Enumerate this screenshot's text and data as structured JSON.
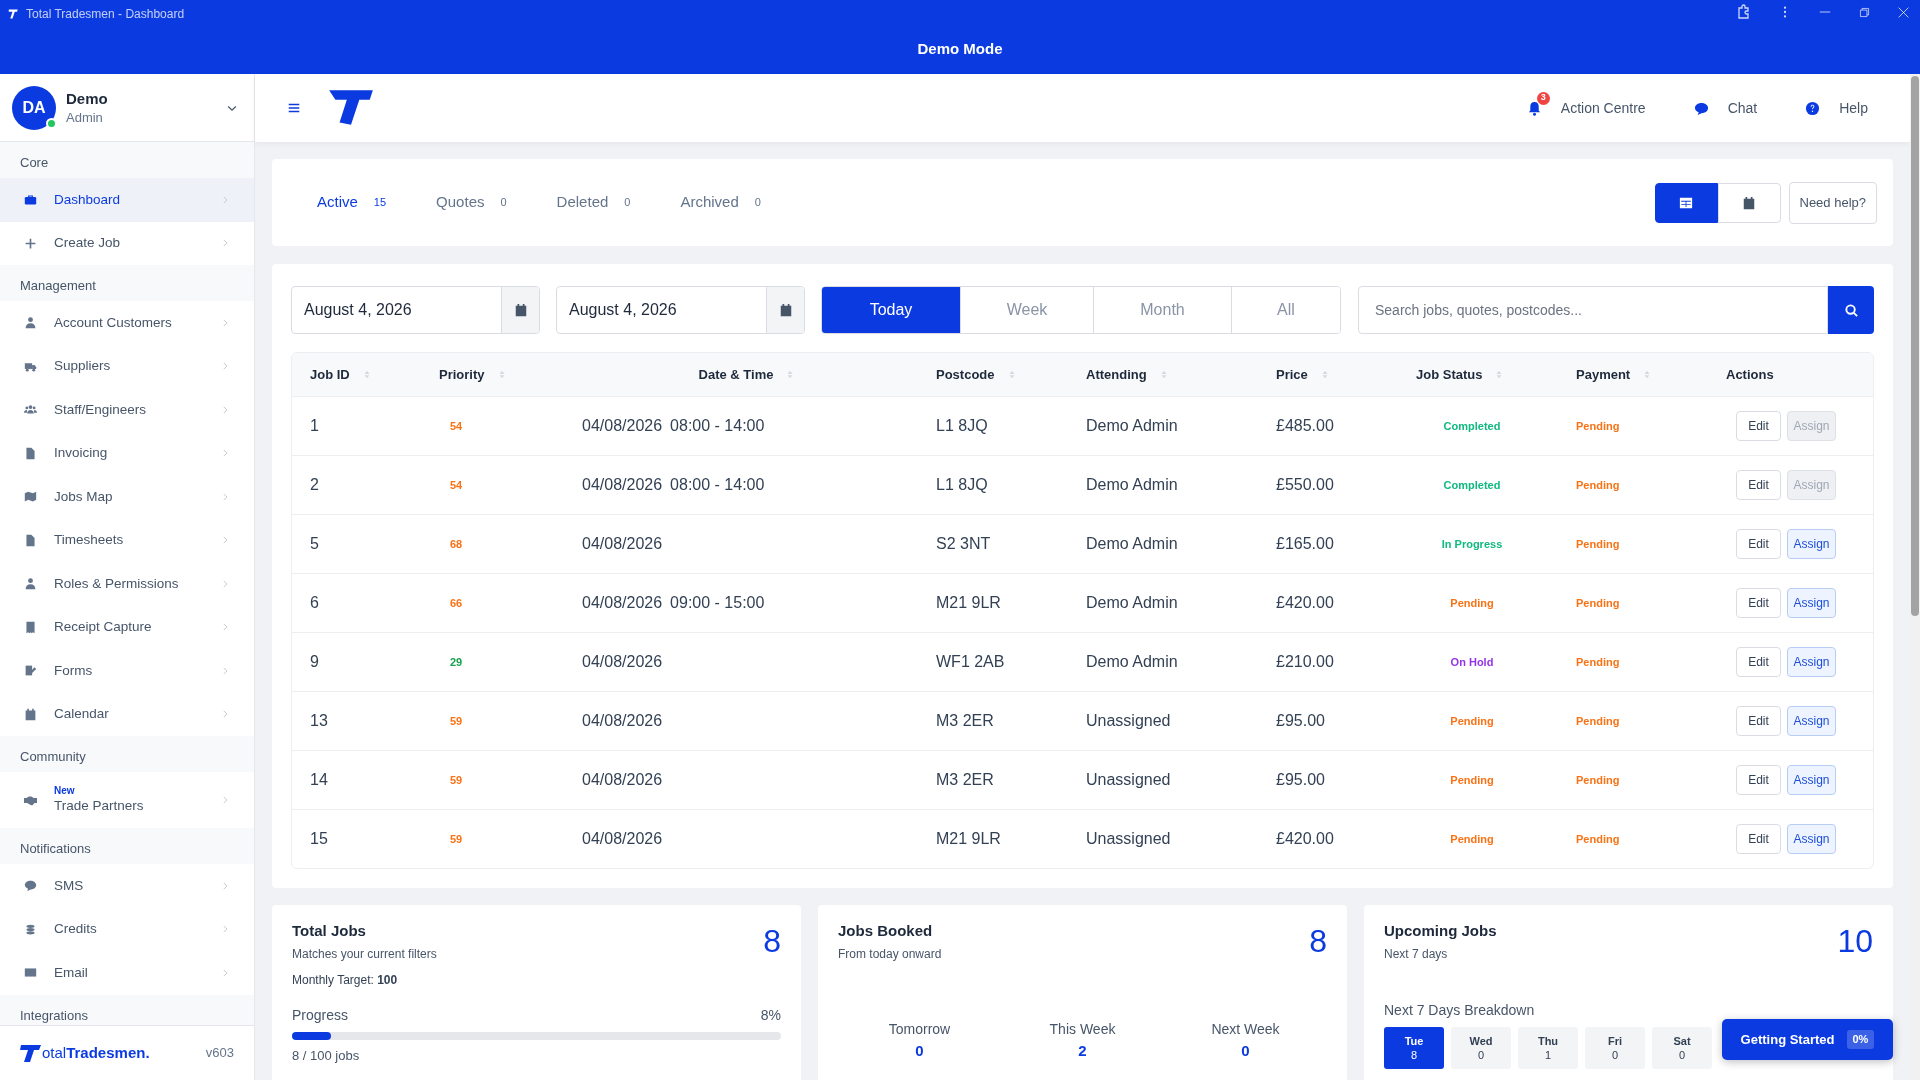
{
  "titlebar": {
    "title": "Total Tradesmen - Dashboard",
    "banner": "Demo Mode"
  },
  "user": {
    "initials": "DA",
    "name": "Demo",
    "role": "Admin",
    "online": true
  },
  "sidebar": {
    "sections": [
      {
        "title": "Core",
        "items": [
          {
            "label": "Dashboard",
            "selected": true
          },
          {
            "label": "Create Job",
            "selected": false
          }
        ]
      },
      {
        "title": "Management",
        "items": [
          {
            "label": "Account Customers",
            "selected": false
          },
          {
            "label": "Suppliers",
            "selected": false
          },
          {
            "label": "Staff/Engineers",
            "selected": false
          },
          {
            "label": "Invoicing",
            "selected": false
          },
          {
            "label": "Jobs Map",
            "selected": false
          },
          {
            "label": "Timesheets",
            "selected": false
          },
          {
            "label": "Roles & Permissions",
            "selected": false
          },
          {
            "label": "Receipt Capture",
            "selected": false
          },
          {
            "label": "Forms",
            "selected": false
          },
          {
            "label": "Calendar",
            "selected": false
          }
        ]
      },
      {
        "title": "Community",
        "items": [
          {
            "label": "Trade Partners",
            "badge": "New",
            "selected": false
          }
        ]
      },
      {
        "title": "Notifications",
        "items": [
          {
            "label": "SMS",
            "selected": false
          },
          {
            "label": "Credits",
            "selected": false
          },
          {
            "label": "Email",
            "selected": false
          }
        ]
      },
      {
        "title": "Integrations"
      }
    ],
    "footer": {
      "brand": "otal**Tradesmen.**",
      "version": "v603"
    }
  },
  "header": {
    "actions": [
      {
        "label": "Action Centre",
        "badge": "3"
      },
      {
        "label": "Chat"
      },
      {
        "label": "Help"
      }
    ]
  },
  "tabs": [
    {
      "label": "Active",
      "count": "15",
      "selected": true
    },
    {
      "label": "Quotes",
      "count": "0",
      "selected": false
    },
    {
      "label": "Deleted",
      "count": "0",
      "selected": false
    },
    {
      "label": "Archived",
      "count": "0",
      "selected": false
    }
  ],
  "views": [
    {
      "kind": "table",
      "selected": true
    },
    {
      "kind": "calendar",
      "selected": false
    }
  ],
  "help_button": "Need help?",
  "filters": {
    "date_from": "August 4, 2026",
    "date_to": "August 4, 2026",
    "ranges": [
      {
        "label": "Today",
        "selected": true
      },
      {
        "label": "Week",
        "selected": false
      },
      {
        "label": "Month",
        "selected": false
      },
      {
        "label": "All",
        "selected": false
      }
    ],
    "search": {
      "placeholder": "Search jobs, quotes, postcodes..."
    }
  },
  "table": {
    "columns": [
      {
        "label": "Job ID",
        "sortable": true
      },
      {
        "label": "Priority",
        "sortable": true
      },
      {
        "label": "Date & Time",
        "sortable": true
      },
      {
        "label": "Postcode",
        "sortable": true
      },
      {
        "label": "Attending",
        "sortable": true
      },
      {
        "label": "Price",
        "sortable": true
      },
      {
        "label": "Job Status",
        "sortable": true
      },
      {
        "label": "Payment",
        "sortable": true
      },
      {
        "label": "Actions",
        "sortable": false
      }
    ],
    "rows": [
      {
        "id": "1",
        "priority": {
          "value": "54",
          "color": "#f97316"
        },
        "date": "04/08/2026",
        "time": "08:00 - 14:00",
        "postcode": "L1 8JQ",
        "attending": "Demo Admin",
        "price": "£485.00",
        "status": {
          "label": "Completed",
          "color": "#10b981"
        },
        "payment": "Pending",
        "edit": "Edit",
        "assign": "Assign",
        "assign_disabled": true
      },
      {
        "id": "2",
        "priority": {
          "value": "54",
          "color": "#f97316"
        },
        "date": "04/08/2026",
        "time": "08:00 - 14:00",
        "postcode": "L1 8JQ",
        "attending": "Demo Admin",
        "price": "£550.00",
        "status": {
          "label": "Completed",
          "color": "#10b981"
        },
        "payment": "Pending",
        "edit": "Edit",
        "assign": "Assign",
        "assign_disabled": true
      },
      {
        "id": "5",
        "priority": {
          "value": "68",
          "color": "#f97316"
        },
        "date": "04/08/2026",
        "postcode": "S2 3NT",
        "attending": "Demo Admin",
        "price": "£165.00",
        "status": {
          "label": "In Progress",
          "color": "#10b981"
        },
        "payment": "Pending",
        "edit": "Edit",
        "assign": "Assign",
        "assign_disabled": false
      },
      {
        "id": "6",
        "priority": {
          "value": "66",
          "color": "#f97316"
        },
        "date": "04/08/2026",
        "time": "09:00 - 15:00",
        "postcode": "M21 9LR",
        "attending": "Demo Admin",
        "price": "£420.00",
        "status": {
          "label": "Pending",
          "color": "#f97316"
        },
        "payment": "Pending",
        "edit": "Edit",
        "assign": "Assign",
        "assign_disabled": false
      },
      {
        "id": "9",
        "priority": {
          "value": "29",
          "color": "#16a34a"
        },
        "date": "04/08/2026",
        "postcode": "WF1 2AB",
        "attending": "Demo Admin",
        "price": "£210.00",
        "status": {
          "label": "On Hold",
          "color": "#9333ea"
        },
        "payment": "Pending",
        "edit": "Edit",
        "assign": "Assign",
        "assign_disabled": false
      },
      {
        "id": "13",
        "priority": {
          "value": "59",
          "color": "#f97316"
        },
        "date": "04/08/2026",
        "postcode": "M3 2ER",
        "attending": "Unassigned",
        "price": "£95.00",
        "status": {
          "label": "Pending",
          "color": "#f97316"
        },
        "payment": "Pending",
        "edit": "Edit",
        "assign": "Assign",
        "assign_disabled": false
      },
      {
        "id": "14",
        "priority": {
          "value": "59",
          "color": "#f97316"
        },
        "date": "04/08/2026",
        "postcode": "M3 2ER",
        "attending": "Unassigned",
        "price": "£95.00",
        "status": {
          "label": "Pending",
          "color": "#f97316"
        },
        "payment": "Pending",
        "edit": "Edit",
        "assign": "Assign",
        "assign_disabled": false
      },
      {
        "id": "15",
        "priority": {
          "value": "59",
          "color": "#f97316"
        },
        "date": "04/08/2026",
        "postcode": "M21 9LR",
        "attending": "Unassigned",
        "price": "£420.00",
        "status": {
          "label": "Pending",
          "color": "#f97316"
        },
        "payment": "Pending",
        "edit": "Edit",
        "assign": "Assign",
        "assign_disabled": false
      }
    ]
  },
  "cards": [
    {
      "kind": "progress",
      "title": "Total Jobs",
      "subtitle": "Matches your current filters",
      "target": "Monthly Target: **100**",
      "count": "8",
      "progress_label": "Progress",
      "percent": "8%",
      "level": 0.08,
      "footnote": "8 / 100 jobs"
    },
    {
      "kind": "stats",
      "title": "Jobs Booked",
      "subtitle": "From today onward",
      "count": "8",
      "stats": [
        {
          "label": "Tomorrow",
          "value": "0"
        },
        {
          "label": "This Week",
          "value": "2"
        },
        {
          "label": "Next Week",
          "value": "0"
        }
      ]
    },
    {
      "kind": "days",
      "title": "Upcoming Jobs",
      "subtitle": "Next 7 days",
      "count": "10",
      "breakdown_title": "Next 7 Days Breakdown",
      "days": [
        {
          "day": "Tue",
          "count": "8",
          "selected": true
        },
        {
          "day": "Wed",
          "count": "0",
          "selected": false
        },
        {
          "day": "Thu",
          "count": "1",
          "selected": false
        },
        {
          "day": "Fri",
          "count": "0",
          "selected": false
        },
        {
          "day": "Sat",
          "count": "0",
          "selected": false
        }
      ]
    }
  ],
  "getting_started": {
    "label": "Getting Started",
    "percent": "0%"
  }
}
